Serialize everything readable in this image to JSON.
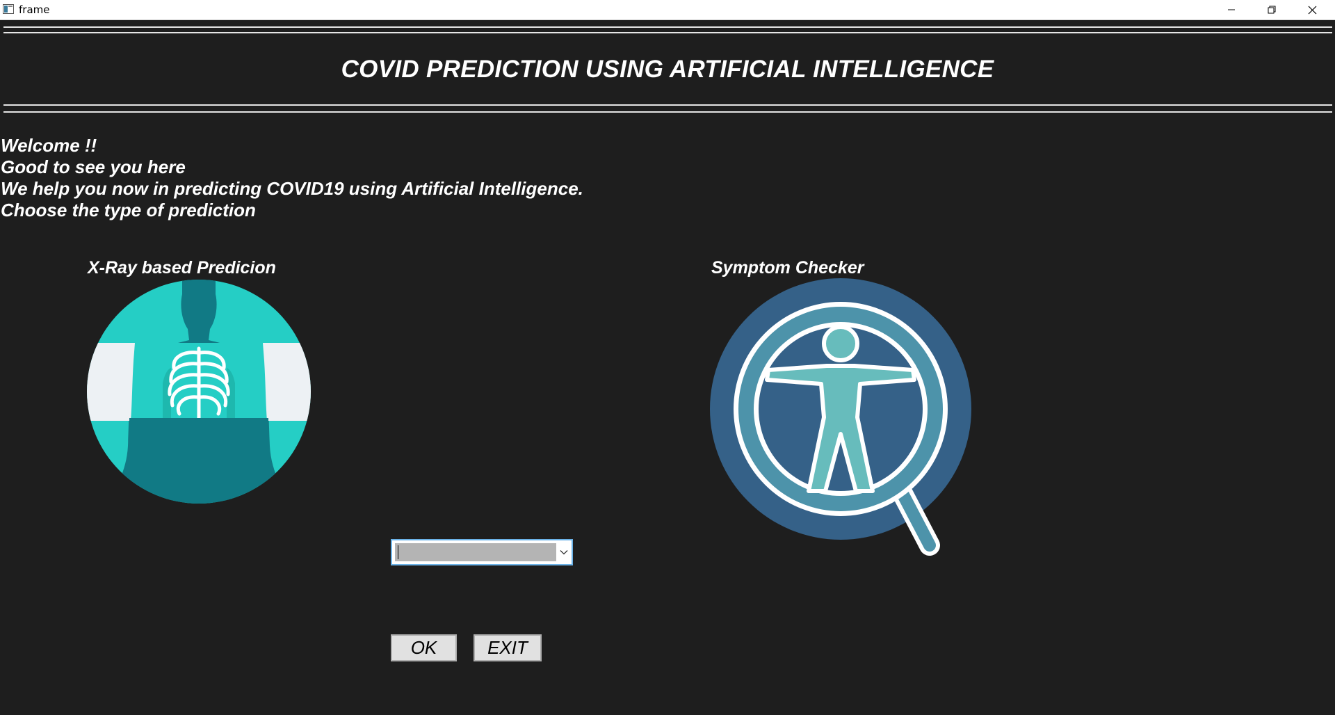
{
  "window": {
    "title": "frame",
    "controls": {
      "minimize": "minimize-icon",
      "maximize": "restore-icon",
      "close": "close-icon"
    }
  },
  "header": {
    "title": "COVID PREDICTION USING ARTIFICIAL INTELLIGENCE"
  },
  "welcome": {
    "lines": [
      "Welcome !!",
      "Good to see you here",
      "We help you now in predicting COVID19 using Artificial Intelligence.",
      "Choose the type of prediction"
    ]
  },
  "options": {
    "xray": {
      "label": "X-Ray based Predicion",
      "icon": "chest-xray-icon"
    },
    "symptom": {
      "label": "Symptom Checker",
      "icon": "symptom-magnifier-icon"
    }
  },
  "selector": {
    "value": "",
    "icon": "chevron-down-icon"
  },
  "buttons": {
    "ok": "OK",
    "exit": "EXIT"
  },
  "colors": {
    "background": "#1e1e1e",
    "teal": "#25cec5",
    "dark_teal": "#117a85",
    "navy": "#356188",
    "light_teal": "#67bcbc",
    "ring_blue": "#4d93aa"
  }
}
